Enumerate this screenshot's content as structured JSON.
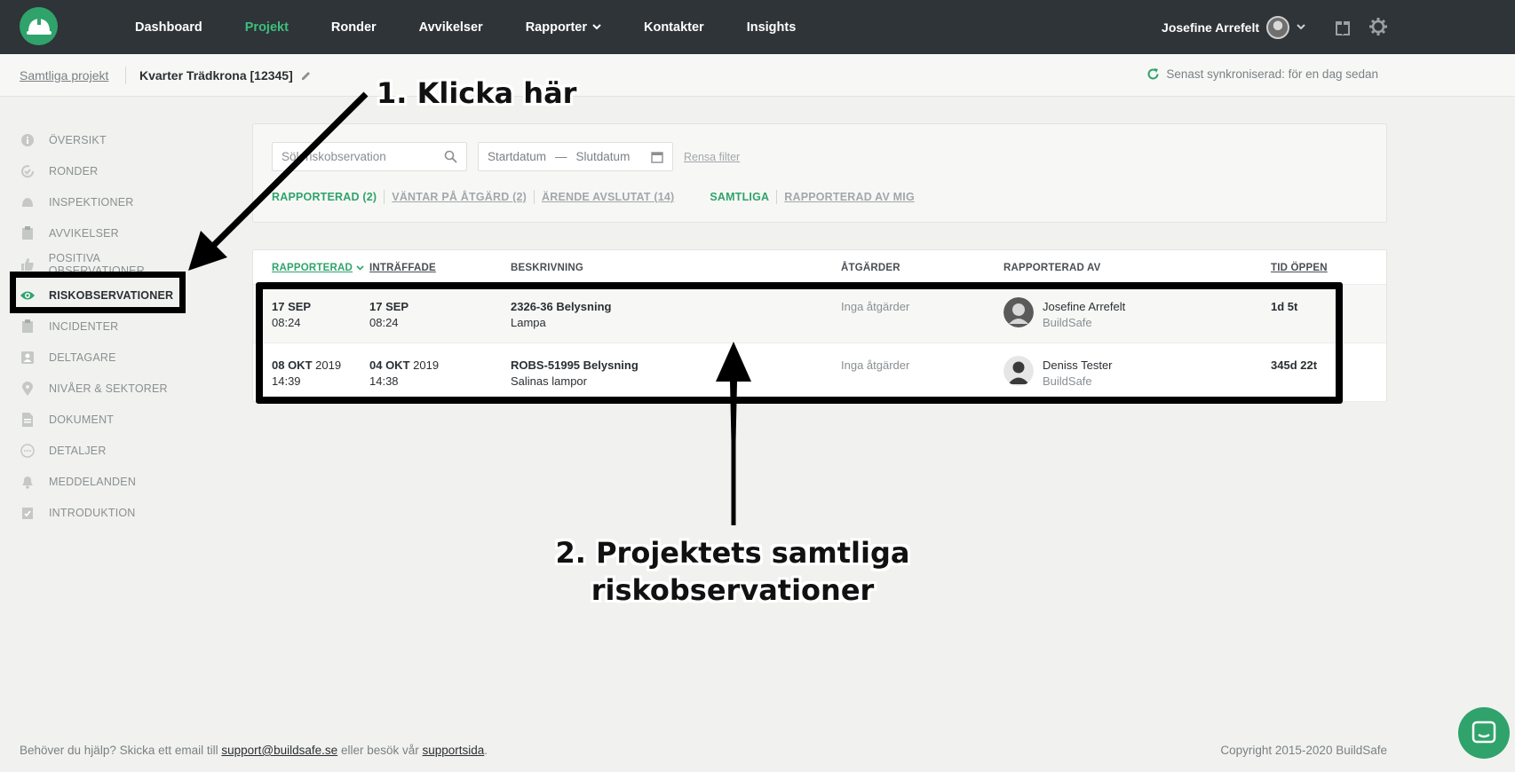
{
  "nav": {
    "items": [
      {
        "label": "Dashboard",
        "active": false
      },
      {
        "label": "Projekt",
        "active": true
      },
      {
        "label": "Ronder",
        "active": false
      },
      {
        "label": "Avvikelser",
        "active": false
      },
      {
        "label": "Rapporter",
        "active": false,
        "dropdown": true
      },
      {
        "label": "Kontakter",
        "active": false
      },
      {
        "label": "Insights",
        "active": false
      }
    ],
    "user_name": "Josefine Arrefelt",
    "icons": [
      "helmet-logo-icon",
      "chevron-down-icon",
      "gift-icon",
      "gear-icon"
    ]
  },
  "breadcrumb": {
    "root": "Samtliga projekt",
    "current": "Kvarter Trädkrona [12345]",
    "sync_text": "Senast synkroniserad: för en dag sedan"
  },
  "sidebar": {
    "items": [
      {
        "label": "ÖVERSIKT",
        "icon": "info-icon",
        "active": false
      },
      {
        "label": "RONDER",
        "icon": "round-check-icon",
        "active": false
      },
      {
        "label": "INSPEKTIONER",
        "icon": "cloud-icon",
        "active": false
      },
      {
        "label": "AVVIKELSER",
        "icon": "clipboard-icon",
        "active": false
      },
      {
        "label": "POSITIVA OBSERVATIONER",
        "icon": "thumbs-up-icon",
        "active": false
      },
      {
        "label": "RISKOBSERVATIONER",
        "icon": "eye-icon",
        "active": true
      },
      {
        "label": "INCIDENTER",
        "icon": "incident-icon",
        "active": false
      },
      {
        "label": "DELTAGARE",
        "icon": "person-icon",
        "active": false
      },
      {
        "label": "NIVÅER & SEKTORER",
        "icon": "pin-icon",
        "active": false
      },
      {
        "label": "DOKUMENT",
        "icon": "document-icon",
        "active": false
      },
      {
        "label": "DETALJER",
        "icon": "dots-icon",
        "active": false
      },
      {
        "label": "MEDDELANDEN",
        "icon": "bell-icon",
        "active": false
      },
      {
        "label": "INTRODUKTION",
        "icon": "checklist-icon",
        "active": false
      }
    ]
  },
  "filters": {
    "search_placeholder": "Sök riskobservation",
    "start_placeholder": "Startdatum",
    "dash": "—",
    "end_placeholder": "Slutdatum",
    "clear_label": "Rensa filter",
    "status_tabs": [
      {
        "label": "RAPPORTERAD (2)",
        "active": true
      },
      {
        "label": "VÄNTAR PÅ ÅTGÄRD (2)",
        "active": false
      },
      {
        "label": "ÄRENDE AVSLUTAT (14)",
        "active": false
      }
    ],
    "scope_tabs": [
      {
        "label": "SAMTLIGA",
        "active": true
      },
      {
        "label": "RAPPORTERAD AV MIG",
        "active": false
      }
    ]
  },
  "table": {
    "columns": [
      "RAPPORTERAD",
      "INTRÄFFADE",
      "BESKRIVNING",
      "ÅTGÄRDER",
      "RAPPORTERAD AV",
      "TID ÖPPEN"
    ],
    "rows": [
      {
        "reported_date": "17 SEP",
        "reported_year": "",
        "reported_time": "08:24",
        "occurred_date": "17 SEP",
        "occurred_year": "",
        "occurred_time": "08:24",
        "title": "2326-36 Belysning",
        "subtitle": "Lampa",
        "actions": "Inga åtgärder",
        "reporter": "Josefine Arrefelt",
        "company": "BuildSafe",
        "open_time": "1d 5t"
      },
      {
        "reported_date": "08 OKT",
        "reported_year": "2019",
        "reported_time": "14:39",
        "occurred_date": "04 OKT",
        "occurred_year": "2019",
        "occurred_time": "14:38",
        "title": "ROBS-51995 Belysning",
        "subtitle": "Salinas lampor",
        "actions": "Inga åtgärder",
        "reporter": "Deniss Tester",
        "company": "BuildSafe",
        "open_time": "345d 22t"
      }
    ]
  },
  "annotations": {
    "step1": "1. Klicka här",
    "step2_line1": "2. Projektets samtliga",
    "step2_line2": "riskobservationer"
  },
  "footer": {
    "help_prefix": "Behöver du hjälp? Skicka ett email till",
    "email": "support@buildsafe.se",
    "help_middle": "eller besök vår",
    "support_link": "supportsida",
    "help_suffix": ".",
    "copyright": "Copyright 2015-2020 BuildSafe"
  },
  "colors": {
    "accent": "#2fa36b",
    "topbar": "#2e3438",
    "background": "#f1f2ef"
  }
}
